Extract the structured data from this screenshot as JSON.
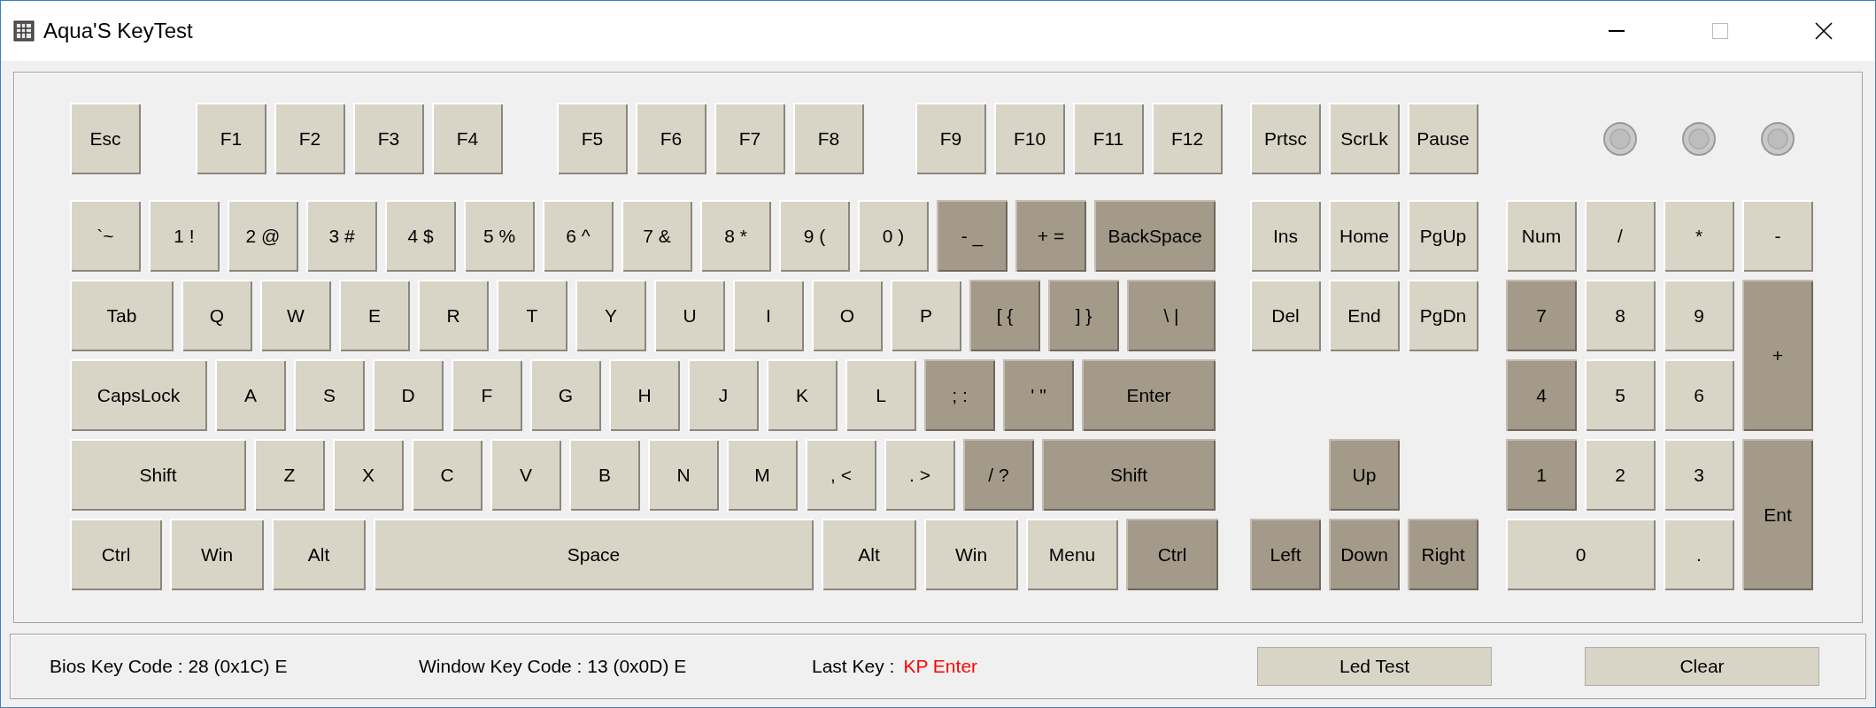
{
  "window": {
    "title": "Aqua'S KeyTest"
  },
  "leds": [
    {
      "on": false
    },
    {
      "on": false
    },
    {
      "on": false
    }
  ],
  "function_row": [
    {
      "label": "Esc",
      "pressed": false
    },
    {
      "label": "F1",
      "pressed": false
    },
    {
      "label": "F2",
      "pressed": false
    },
    {
      "label": "F3",
      "pressed": false
    },
    {
      "label": "F4",
      "pressed": false
    },
    {
      "label": "F5",
      "pressed": false
    },
    {
      "label": "F6",
      "pressed": false
    },
    {
      "label": "F7",
      "pressed": false
    },
    {
      "label": "F8",
      "pressed": false
    },
    {
      "label": "F9",
      "pressed": false
    },
    {
      "label": "F10",
      "pressed": false
    },
    {
      "label": "F11",
      "pressed": false
    },
    {
      "label": "F12",
      "pressed": false
    }
  ],
  "main_rows": [
    {
      "keys": [
        {
          "label": "`~",
          "pressed": false
        },
        {
          "label": "1 !",
          "pressed": false
        },
        {
          "label": "2 @",
          "pressed": false
        },
        {
          "label": "3 #",
          "pressed": false
        },
        {
          "label": "4 $",
          "pressed": false
        },
        {
          "label": "5 %",
          "pressed": false
        },
        {
          "label": "6 ^",
          "pressed": false
        },
        {
          "label": "7 &",
          "pressed": false
        },
        {
          "label": "8 *",
          "pressed": false
        },
        {
          "label": "9 (",
          "pressed": false
        },
        {
          "label": "0 )",
          "pressed": false
        },
        {
          "label": "- _",
          "pressed": true
        },
        {
          "label": "+ =",
          "pressed": true
        },
        {
          "label": "BackSpace",
          "pressed": true
        }
      ]
    },
    {
      "keys": [
        {
          "label": "Tab",
          "pressed": false
        },
        {
          "label": "Q",
          "pressed": false
        },
        {
          "label": "W",
          "pressed": false
        },
        {
          "label": "E",
          "pressed": false
        },
        {
          "label": "R",
          "pressed": false
        },
        {
          "label": "T",
          "pressed": false
        },
        {
          "label": "Y",
          "pressed": false
        },
        {
          "label": "U",
          "pressed": false
        },
        {
          "label": "I",
          "pressed": false
        },
        {
          "label": "O",
          "pressed": false
        },
        {
          "label": "P",
          "pressed": false
        },
        {
          "label": "[ {",
          "pressed": true
        },
        {
          "label": "] }",
          "pressed": true
        },
        {
          "label": "\\ |",
          "pressed": true
        }
      ]
    },
    {
      "keys": [
        {
          "label": "CapsLock",
          "pressed": false
        },
        {
          "label": "A",
          "pressed": false
        },
        {
          "label": "S",
          "pressed": false
        },
        {
          "label": "D",
          "pressed": false
        },
        {
          "label": "F",
          "pressed": false
        },
        {
          "label": "G",
          "pressed": false
        },
        {
          "label": "H",
          "pressed": false
        },
        {
          "label": "J",
          "pressed": false
        },
        {
          "label": "K",
          "pressed": false
        },
        {
          "label": "L",
          "pressed": false
        },
        {
          "label": "; :",
          "pressed": true
        },
        {
          "label": "' \"",
          "pressed": true
        },
        {
          "label": "Enter",
          "pressed": true
        }
      ]
    },
    {
      "keys": [
        {
          "label": "Shift",
          "pressed": false
        },
        {
          "label": "Z",
          "pressed": false
        },
        {
          "label": "X",
          "pressed": false
        },
        {
          "label": "C",
          "pressed": false
        },
        {
          "label": "V",
          "pressed": false
        },
        {
          "label": "B",
          "pressed": false
        },
        {
          "label": "N",
          "pressed": false
        },
        {
          "label": "M",
          "pressed": false
        },
        {
          "label": ", <",
          "pressed": false
        },
        {
          "label": ". >",
          "pressed": false
        },
        {
          "label": "/ ?",
          "pressed": true
        },
        {
          "label": "Shift",
          "pressed": true
        }
      ]
    },
    {
      "keys": [
        {
          "label": "Ctrl",
          "pressed": false
        },
        {
          "label": "Win",
          "pressed": false
        },
        {
          "label": "Alt",
          "pressed": false
        },
        {
          "label": "Space",
          "pressed": false
        },
        {
          "label": "Alt",
          "pressed": false
        },
        {
          "label": "Win",
          "pressed": false
        },
        {
          "label": "Menu",
          "pressed": false
        },
        {
          "label": "Ctrl",
          "pressed": true
        }
      ]
    }
  ],
  "navigation_keys": [
    {
      "label": "Prtsc",
      "pressed": false
    },
    {
      "label": "ScrLk",
      "pressed": false
    },
    {
      "label": "Pause",
      "pressed": false
    },
    {
      "label": "Ins",
      "pressed": false
    },
    {
      "label": "Home",
      "pressed": false
    },
    {
      "label": "PgUp",
      "pressed": false
    },
    {
      "label": "Del",
      "pressed": false
    },
    {
      "label": "End",
      "pressed": false
    },
    {
      "label": "PgDn",
      "pressed": false
    },
    {
      "label": "Up",
      "pressed": true
    },
    {
      "label": "Left",
      "pressed": true
    },
    {
      "label": "Down",
      "pressed": true
    },
    {
      "label": "Right",
      "pressed": true
    }
  ],
  "numpad_keys": [
    {
      "label": "Num",
      "pressed": false
    },
    {
      "label": "/",
      "pressed": false
    },
    {
      "label": "*",
      "pressed": false
    },
    {
      "label": "-",
      "pressed": false
    },
    {
      "label": "7",
      "pressed": true
    },
    {
      "label": "8",
      "pressed": false
    },
    {
      "label": "9",
      "pressed": false
    },
    {
      "label": "+",
      "pressed": true
    },
    {
      "label": "4",
      "pressed": true
    },
    {
      "label": "5",
      "pressed": false
    },
    {
      "label": "6",
      "pressed": false
    },
    {
      "label": "1",
      "pressed": true
    },
    {
      "label": "2",
      "pressed": false
    },
    {
      "label": "3",
      "pressed": false
    },
    {
      "label": "Ent",
      "pressed": true
    },
    {
      "label": "0",
      "pressed": false
    },
    {
      "label": ".",
      "pressed": false
    }
  ],
  "status_bar": {
    "bios_key_code": "Bios Key Code : 28 (0x1C) E",
    "window_key_code": "Window Key Code : 13 (0x0D) E",
    "last_key_label": "Last Key :",
    "last_key_value": "KP Enter",
    "buttons": [
      "Led Test",
      "Clear"
    ]
  }
}
